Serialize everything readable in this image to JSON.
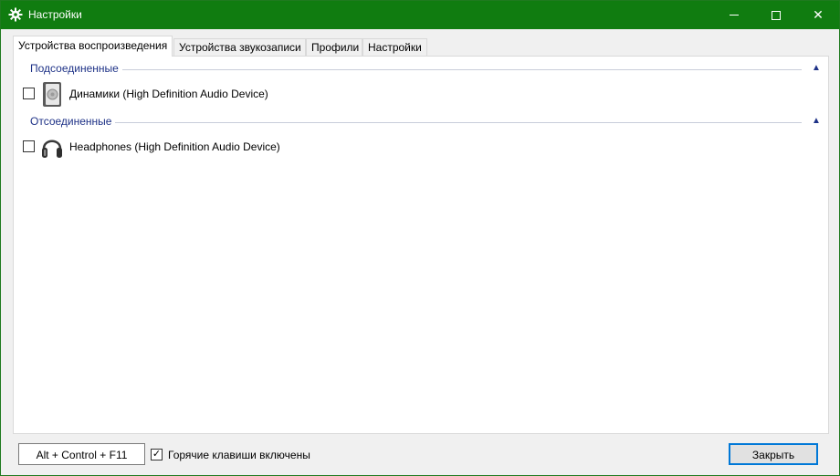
{
  "window": {
    "title": "Настройки",
    "icon": "gear-icon"
  },
  "controls": {
    "minimize": "minimize-icon",
    "maximize": "maximize-icon",
    "close": "✕"
  },
  "tabs": [
    {
      "label": "Устройства воспроизведения",
      "active": true
    },
    {
      "label": "Устройства звукозаписи",
      "active": false
    },
    {
      "label": "Профили",
      "active": false
    },
    {
      "label": "Настройки",
      "active": false
    }
  ],
  "groups": [
    {
      "label": "Подсоединенные",
      "toggle": "▲",
      "devices": [
        {
          "label": "Динамики (High Definition Audio Device)",
          "icon": "speaker-icon",
          "checked": false
        }
      ]
    },
    {
      "label": "Отсоединенные",
      "toggle": "▲",
      "devices": [
        {
          "label": "Headphones (High Definition Audio Device)",
          "icon": "headphones-icon",
          "checked": false
        }
      ]
    }
  ],
  "footer": {
    "hotkey": "Alt + Control + F11",
    "hotkeys_enabled_label": "Горячие клавиши включены",
    "hotkeys_enabled": true,
    "check_mark": "✓",
    "close_label": "Закрыть"
  },
  "colors": {
    "titlebar": "#107c10",
    "group_label": "#1e3287",
    "button_border": "#0078d7"
  }
}
